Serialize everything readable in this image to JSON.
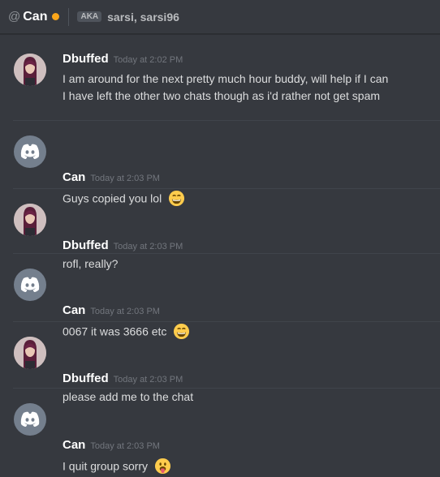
{
  "header": {
    "at_symbol": "@",
    "channel_name": "Can",
    "aka_label": "AKA",
    "aka_names": "sarsi, sarsi96"
  },
  "messages": [
    {
      "author": "Dbuffed",
      "timestamp": "Today at 2:02 PM",
      "lines": [
        "I am around for the next pretty much hour buddy, will help if I can",
        "I have left the other two chats though as i'd rather not get spam"
      ],
      "emoji": ""
    },
    {
      "author": "Can",
      "timestamp": "Today at 2:03 PM",
      "lines": [
        "Guys copied you lol"
      ],
      "emoji": "grin-emoji"
    },
    {
      "author": "Dbuffed",
      "timestamp": "Today at 2:03 PM",
      "lines": [
        "rofl, really?"
      ],
      "emoji": ""
    },
    {
      "author": "Can",
      "timestamp": "Today at 2:03 PM",
      "lines": [
        "0067 it was 3666 etc"
      ],
      "emoji": "grin-emoji"
    },
    {
      "author": "Dbuffed",
      "timestamp": "Today at 2:03 PM",
      "lines": [
        "please add me to the chat"
      ],
      "emoji": ""
    },
    {
      "author": "Can",
      "timestamp": "Today at 2:03 PM",
      "lines": [
        "I quit group sorry"
      ],
      "emoji": "tongue-emoji"
    }
  ],
  "colors": {
    "background": "#36393f",
    "status_idle": "#faa61a",
    "username": "#ffffff",
    "timestamp": "#72767d",
    "text": "#dcddde",
    "discord_avatar": "#747f8d"
  }
}
